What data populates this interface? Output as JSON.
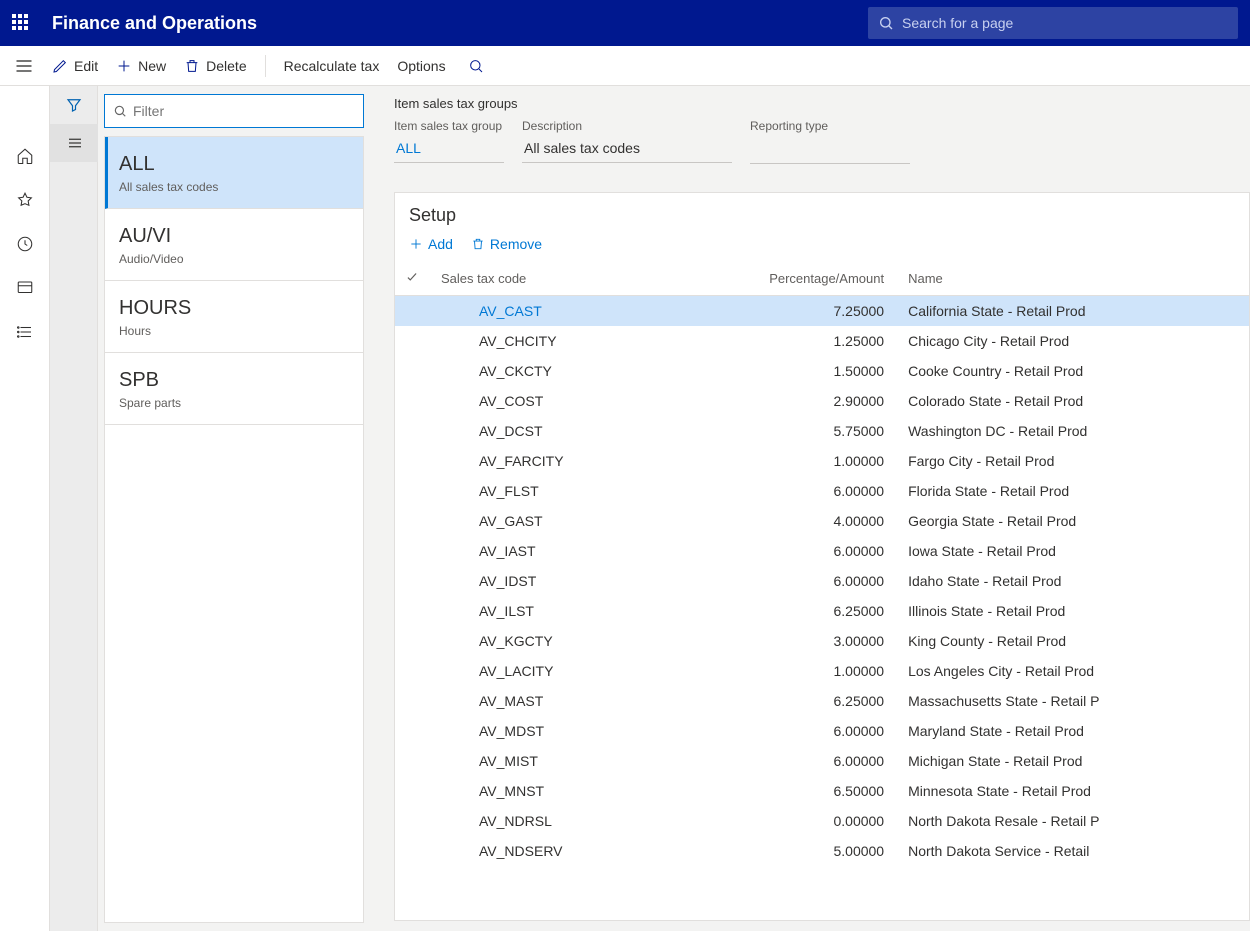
{
  "header": {
    "app_title": "Finance and Operations",
    "search_placeholder": "Search for a page"
  },
  "commands": {
    "edit": "Edit",
    "new": "New",
    "delete": "Delete",
    "recalculate": "Recalculate tax",
    "options": "Options"
  },
  "filter": {
    "placeholder": "Filter"
  },
  "groups": [
    {
      "code": "ALL",
      "desc": "All sales tax codes",
      "selected": true
    },
    {
      "code": "AU/VI",
      "desc": "Audio/Video",
      "selected": false
    },
    {
      "code": "HOURS",
      "desc": "Hours",
      "selected": false
    },
    {
      "code": "SPB",
      "desc": "Spare parts",
      "selected": false
    }
  ],
  "page": {
    "title": "Item sales tax groups",
    "field_group_label": "Item sales tax group",
    "field_group_value": "ALL",
    "field_desc_label": "Description",
    "field_desc_value": "All sales tax codes",
    "field_rep_label": "Reporting type",
    "field_rep_value": ""
  },
  "setup": {
    "title": "Setup",
    "add": "Add",
    "remove": "Remove",
    "columns": {
      "code": "Sales tax code",
      "pct": "Percentage/Amount",
      "name": "Name"
    },
    "rows": [
      {
        "code": "AV_CAST",
        "pct": "7.25000",
        "name": "California State - Retail Prod",
        "selected": true
      },
      {
        "code": "AV_CHCITY",
        "pct": "1.25000",
        "name": "Chicago City - Retail Prod"
      },
      {
        "code": "AV_CKCTY",
        "pct": "1.50000",
        "name": "Cooke Country - Retail Prod"
      },
      {
        "code": "AV_COST",
        "pct": "2.90000",
        "name": "Colorado State - Retail Prod"
      },
      {
        "code": "AV_DCST",
        "pct": "5.75000",
        "name": "Washington DC - Retail Prod"
      },
      {
        "code": "AV_FARCITY",
        "pct": "1.00000",
        "name": "Fargo City - Retail Prod"
      },
      {
        "code": "AV_FLST",
        "pct": "6.00000",
        "name": "Florida State - Retail Prod"
      },
      {
        "code": "AV_GAST",
        "pct": "4.00000",
        "name": "Georgia State - Retail Prod"
      },
      {
        "code": "AV_IAST",
        "pct": "6.00000",
        "name": "Iowa State - Retail Prod"
      },
      {
        "code": "AV_IDST",
        "pct": "6.00000",
        "name": "Idaho State - Retail Prod"
      },
      {
        "code": "AV_ILST",
        "pct": "6.25000",
        "name": "Illinois State - Retail Prod"
      },
      {
        "code": "AV_KGCTY",
        "pct": "3.00000",
        "name": "King County - Retail Prod"
      },
      {
        "code": "AV_LACITY",
        "pct": "1.00000",
        "name": "Los Angeles City - Retail Prod"
      },
      {
        "code": "AV_MAST",
        "pct": "6.25000",
        "name": "Massachusetts State - Retail P"
      },
      {
        "code": "AV_MDST",
        "pct": "6.00000",
        "name": "Maryland State - Retail Prod"
      },
      {
        "code": "AV_MIST",
        "pct": "6.00000",
        "name": "Michigan State - Retail Prod"
      },
      {
        "code": "AV_MNST",
        "pct": "6.50000",
        "name": "Minnesota State - Retail Prod"
      },
      {
        "code": "AV_NDRSL",
        "pct": "0.00000",
        "name": "North Dakota Resale - Retail P"
      },
      {
        "code": "AV_NDSERV",
        "pct": "5.00000",
        "name": "North Dakota Service - Retail"
      }
    ]
  }
}
